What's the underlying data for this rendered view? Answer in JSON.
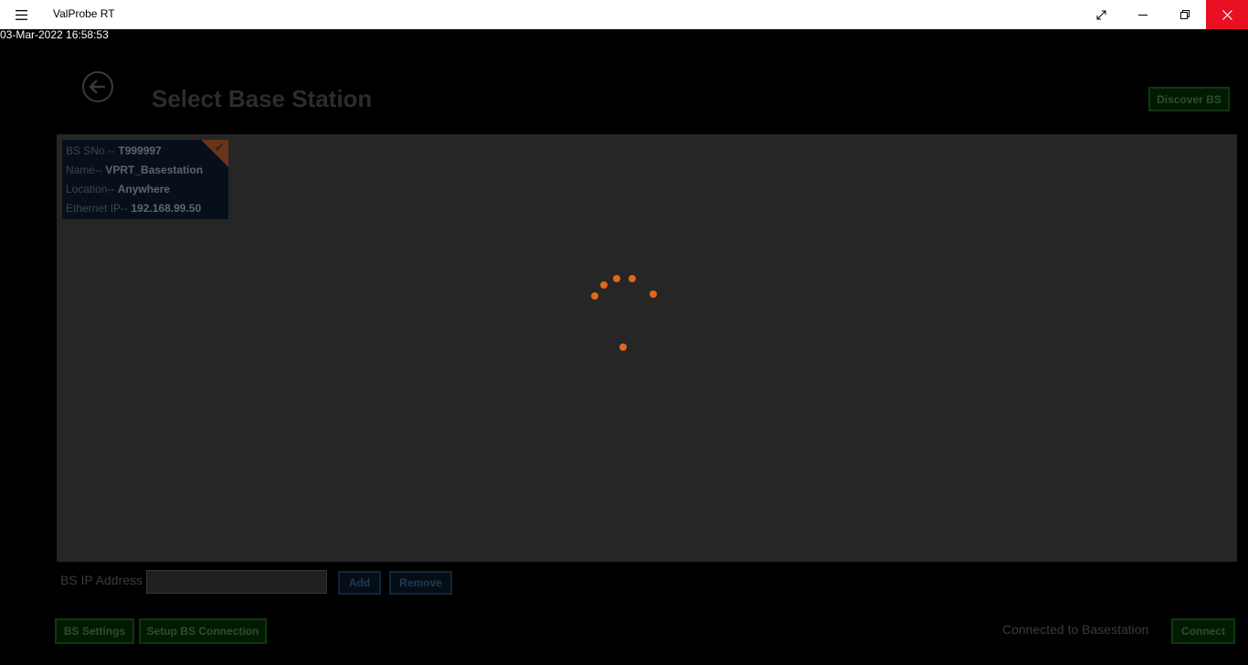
{
  "window": {
    "title": "ValProbe RT",
    "buttons": {
      "expand": "⤢",
      "minimize": "—",
      "restore": "❐",
      "close": "✕"
    }
  },
  "datetime": "03-Mar-2022 16:58:53",
  "page": {
    "title": "Select Base Station",
    "discover_label": "Discover BS"
  },
  "base_station_card": {
    "sno_label": "BS SNo.-- ",
    "sno_value": "T999997",
    "name_label": "Name-- ",
    "name_value": "VPRT_Basestation",
    "location_label": "Location-- ",
    "location_value": "Anywhere",
    "ip_label": "Ethernet IP-- ",
    "ip_value": "192.168.99.50",
    "selected": true
  },
  "ip_entry": {
    "label": "BS IP Address",
    "value": "",
    "add_label": "Add",
    "remove_label": "Remove"
  },
  "footer": {
    "settings_label": "BS Settings",
    "setup_label": "Setup BS Connection",
    "status": "Connected to Basestation",
    "connect_label": "Connect"
  },
  "colors": {
    "spinner": "#e0681a",
    "close_button": "#e81123",
    "panel": "#262626"
  },
  "icons": [
    "hamburger-icon",
    "back-arrow-icon",
    "checkmark-icon",
    "loading-spinner"
  ]
}
